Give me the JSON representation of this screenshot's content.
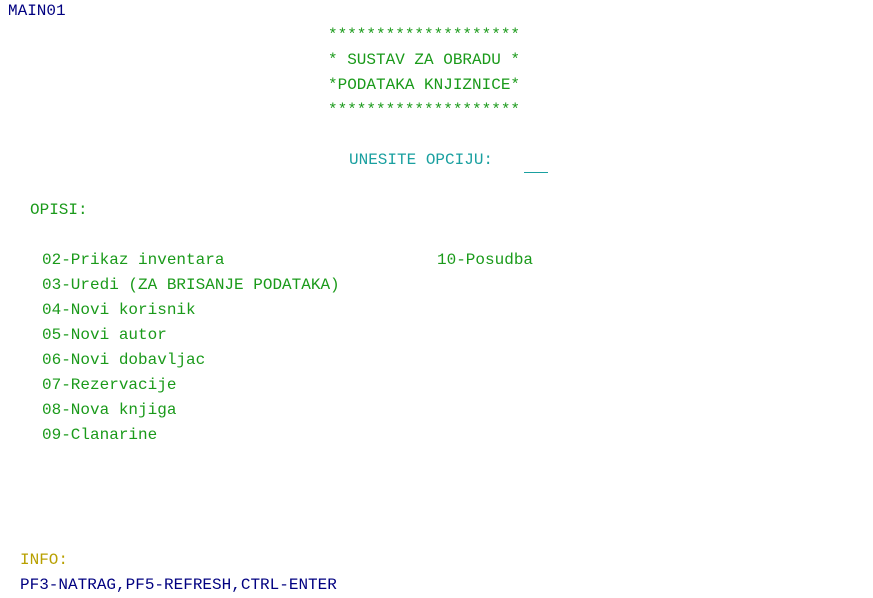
{
  "screen_id": "MAIN01",
  "banner": {
    "line1": "********************",
    "line2": "* SUSTAV ZA OBRADU *",
    "line3": "*PODATAKA KNJIZNICE*",
    "line4": "********************"
  },
  "prompt": {
    "label": "UNESITE OPCIJU:",
    "value": ""
  },
  "options_header": "OPISI:",
  "options": [
    "02-Prikaz inventara",
    "03-Uredi (ZA BRISANJE PODATAKA)",
    "04-Novi korisnik",
    "05-Novi autor",
    "06-Novi dobavljac",
    "07-Rezervacije",
    "08-Nova knjiga",
    "09-Clanarine"
  ],
  "option_right": "10-Posudba",
  "info": {
    "label": "INFO:",
    "keys": "PF3-NATRAG,PF5-REFRESH,CTRL-ENTER"
  },
  "colors": {
    "banner": "#1a9a1a",
    "prompt": "#1aa0a0",
    "info_label": "#b8a000",
    "screen_id": "#000080"
  }
}
